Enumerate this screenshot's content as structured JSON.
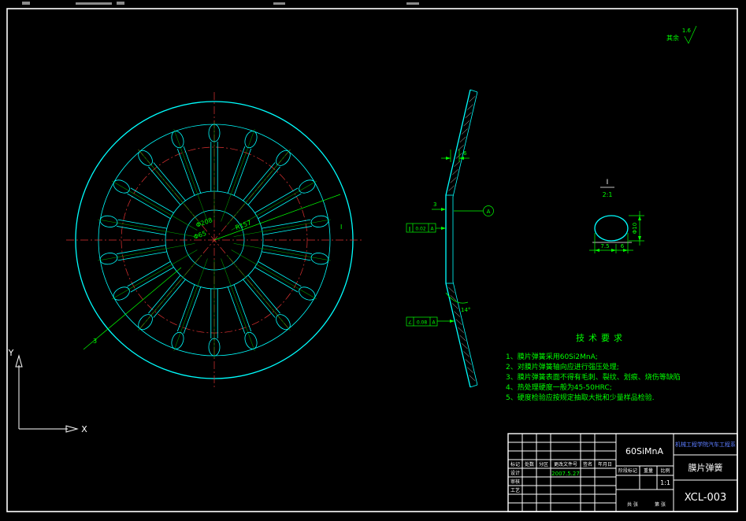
{
  "colors": {
    "cyan": "#00ffff",
    "red": "#e03232",
    "green": "#00ff00",
    "white": "#ffffff",
    "blue": "#5b7cff"
  },
  "roughness": {
    "label": "其余",
    "value": "1.6"
  },
  "main_view": {
    "dim_outer": "Φ208",
    "dim_inner": "Φ65",
    "dim_radius": "R157",
    "dim_slot": "3",
    "detail_ref": "I"
  },
  "side_view": {
    "dim_width": "6",
    "dim_thickness": "3",
    "dim_angle": "14°",
    "fcf1": {
      "sym": "∥",
      "tol": "0.02",
      "datum": "A"
    },
    "fcf2": {
      "sym": "∠",
      "tol": "0.08",
      "datum": "A"
    },
    "datum": "A"
  },
  "detail_view": {
    "label": "I",
    "scale": "2:1",
    "dim_a": "7.5",
    "dim_b": "6",
    "dim_c": "Φ10"
  },
  "tech_req": {
    "title": "技术要求",
    "items": [
      "1、膜片弹簧采用60Si2MnA;",
      "2、对膜片弹簧轴向应进行强压处理;",
      "3、膜片弹簧表面不得有毛刺、裂纹、划痕、烧伤等缺陷",
      "4、热处理硬度一般为45-50HRC;",
      "5、硬度检验应按规定抽取大批和少量样品检验."
    ]
  },
  "title_block": {
    "material": "60SiMnA",
    "org": "机械工程学院汽车工程系",
    "part_name": "膜片弹簧",
    "drawing_no": "XCL-003",
    "date": "2007.5.27",
    "rev_headers": [
      "标记",
      "处数",
      "分区",
      "更改文件号",
      "签名",
      "年月日"
    ],
    "roles": [
      "设计",
      "审核",
      "工艺"
    ],
    "stage_label": "阶段标记",
    "weight_label": "重量",
    "scale_label": "比例",
    "scale_value": "1:1",
    "sheet_total": "共 张",
    "sheet_no": "第 张"
  },
  "ucs": {
    "x": "X",
    "y": "Y"
  }
}
